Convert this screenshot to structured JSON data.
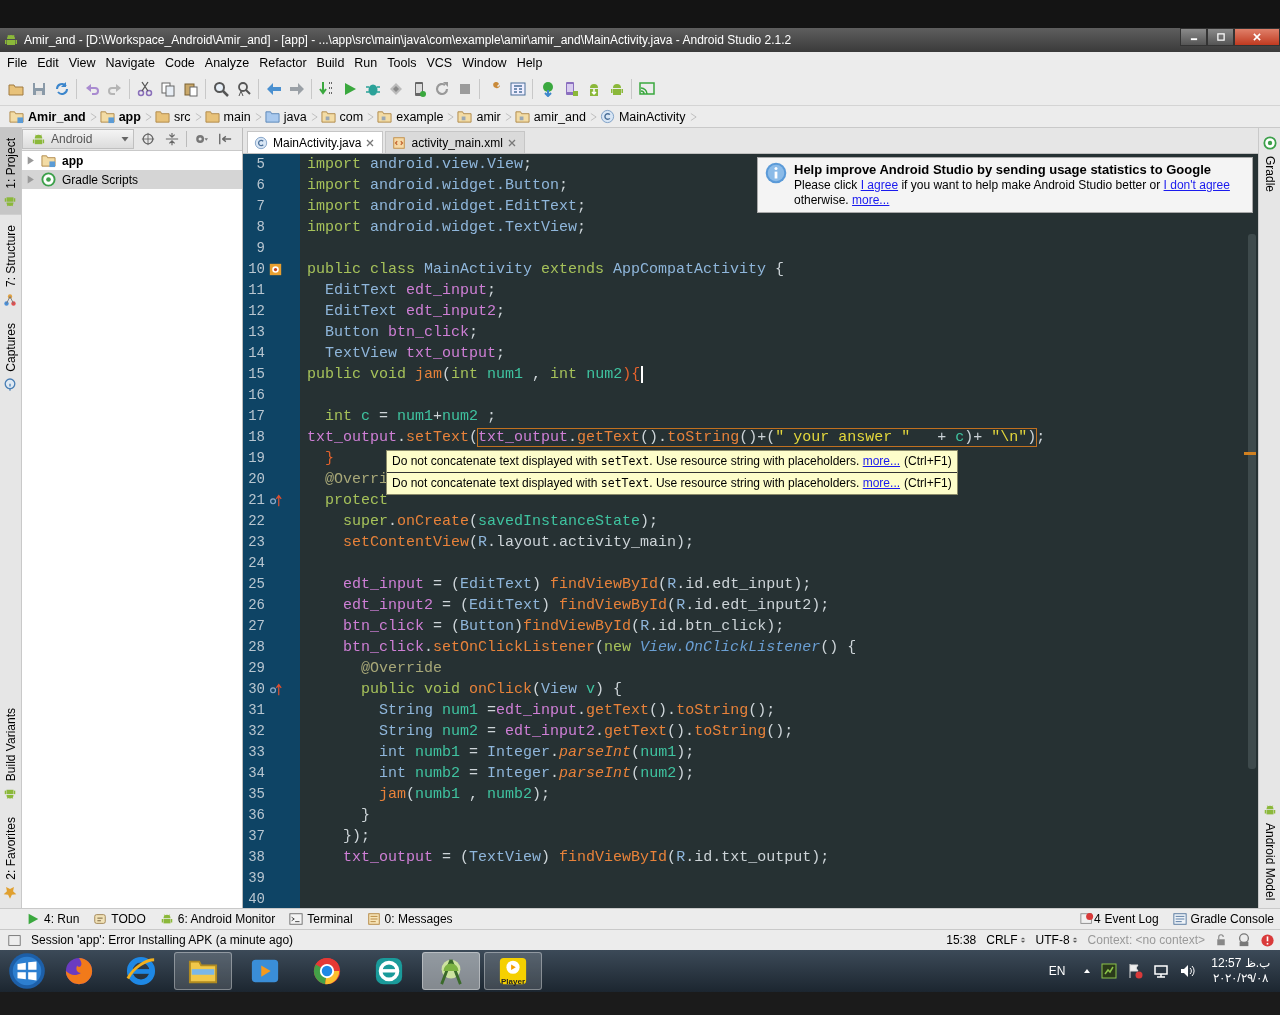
{
  "title_bar": {
    "title": "Amir_and - [D:\\Workspace_Android\\Amir_and] - [app] - ...\\app\\src\\main\\java\\com\\example\\amir\\amir_and\\MainActivity.java - Android Studio 2.1.2"
  },
  "menu": [
    "File",
    "Edit",
    "View",
    "Navigate",
    "Code",
    "Analyze",
    "Refactor",
    "Build",
    "Run",
    "Tools",
    "VCS",
    "Window",
    "Help"
  ],
  "breadcrumb": [
    {
      "label": "Amir_and",
      "kind": "module"
    },
    {
      "label": "app",
      "kind": "module"
    },
    {
      "label": "src",
      "kind": "folder"
    },
    {
      "label": "main",
      "kind": "folder"
    },
    {
      "label": "java",
      "kind": "source"
    },
    {
      "label": "com",
      "kind": "package"
    },
    {
      "label": "example",
      "kind": "package"
    },
    {
      "label": "amir",
      "kind": "package"
    },
    {
      "label": "amir_and",
      "kind": "package"
    },
    {
      "label": "MainActivity",
      "kind": "class"
    }
  ],
  "left_stripe": {
    "top": [
      {
        "label": "1: Project",
        "kind": "robot",
        "selected": true
      },
      {
        "label": "7: Structure",
        "kind": "structure",
        "selected": false
      },
      {
        "label": "Captures",
        "kind": "capture",
        "selected": false
      }
    ],
    "bottom": [
      {
        "label": "Build Variants",
        "kind": "robot",
        "selected": false
      },
      {
        "label": "2: Favorites",
        "kind": "star",
        "selected": false
      }
    ]
  },
  "project_panel": {
    "view": "Android",
    "tree": [
      {
        "label": "app",
        "kind": "module",
        "expanded": false,
        "selected": false
      },
      {
        "label": "Gradle Scripts",
        "kind": "gradle",
        "expanded": false,
        "selected": true
      }
    ]
  },
  "editor_tabs": [
    {
      "label": "MainActivity.java",
      "kind": "class",
      "selected": true
    },
    {
      "label": "activity_main.xml",
      "kind": "xml",
      "selected": false
    }
  ],
  "code_lines": [
    {
      "n": "5",
      "tokens": [
        {
          "text": "import ",
          "kind": "kw"
        },
        {
          "text": "android.view.View",
          "kind": "type"
        },
        {
          "text": ";",
          "kind": "p"
        }
      ]
    },
    {
      "n": "6",
      "tokens": [
        {
          "text": "import ",
          "kind": "kw"
        },
        {
          "text": "android.widget.Button",
          "kind": "type"
        },
        {
          "text": ";",
          "kind": "p"
        }
      ]
    },
    {
      "n": "7",
      "tokens": [
        {
          "text": "import ",
          "kind": "kw"
        },
        {
          "text": "android.widget.EditText",
          "kind": "type"
        },
        {
          "text": ";",
          "kind": "p"
        }
      ]
    },
    {
      "n": "8",
      "tokens": [
        {
          "text": "import ",
          "kind": "kw"
        },
        {
          "text": "android.widget.TextView",
          "kind": "type"
        },
        {
          "text": ";",
          "kind": "p"
        }
      ]
    },
    {
      "n": "9"
    },
    {
      "n": "10",
      "kind": "class",
      "tokens": [
        {
          "text": "public class ",
          "kind": "kw"
        },
        {
          "text": "MainActivity ",
          "kind": "type"
        },
        {
          "text": "extends ",
          "kind": "kw"
        },
        {
          "text": "AppCompatActivity ",
          "kind": "type"
        },
        {
          "text": "{",
          "kind": "p"
        }
      ]
    },
    {
      "n": "11",
      "tokens": [
        {
          "text": "  EditText ",
          "kind": "type"
        },
        {
          "text": "edt_input",
          "kind": "field"
        },
        {
          "text": ";",
          "kind": "p"
        }
      ]
    },
    {
      "n": "12",
      "tokens": [
        {
          "text": "  EditText ",
          "kind": "type"
        },
        {
          "text": "edt_input2",
          "kind": "field"
        },
        {
          "text": ";",
          "kind": "p"
        }
      ]
    },
    {
      "n": "13",
      "tokens": [
        {
          "text": "  Button ",
          "kind": "type"
        },
        {
          "text": "btn_click",
          "kind": "field"
        },
        {
          "text": ";",
          "kind": "p"
        }
      ]
    },
    {
      "n": "14",
      "tokens": [
        {
          "text": "  TextView ",
          "kind": "type"
        },
        {
          "text": "txt_output",
          "kind": "field"
        },
        {
          "text": ";",
          "kind": "p"
        }
      ]
    },
    {
      "n": "15",
      "caret": true,
      "tokens": [
        {
          "text": "public void ",
          "kind": "kw"
        },
        {
          "text": "jam",
          "kind": "method"
        },
        {
          "text": "(",
          "kind": "p"
        },
        {
          "text": "int ",
          "kind": "kw"
        },
        {
          "text": "num1 ",
          "kind": "local"
        },
        {
          "text": ", ",
          "kind": "p"
        },
        {
          "text": "int ",
          "kind": "kw"
        },
        {
          "text": "num2",
          "kind": "local"
        },
        {
          "text": "){",
          "kind": "match"
        }
      ]
    },
    {
      "n": "16"
    },
    {
      "n": "17",
      "tokens": [
        {
          "text": "  int ",
          "kind": "kw"
        },
        {
          "text": "c ",
          "kind": "local"
        },
        {
          "text": "= ",
          "kind": "p"
        },
        {
          "text": "num1",
          "kind": "local"
        },
        {
          "text": "+",
          "kind": "p"
        },
        {
          "text": "num2 ",
          "kind": "local"
        },
        {
          "text": ";",
          "kind": "p"
        }
      ]
    },
    {
      "n": "18",
      "segments": [
        {
          "highlighted": false,
          "tokens": [
            {
              "text": "txt_output",
              "kind": "field"
            },
            {
              "text": ".",
              "kind": "p"
            },
            {
              "text": "setText",
              "kind": "method"
            },
            {
              "text": "(",
              "kind": "p"
            }
          ]
        },
        {
          "highlighted": true,
          "tokens": [
            {
              "text": "txt_output",
              "kind": "field"
            },
            {
              "text": ".",
              "kind": "p"
            },
            {
              "text": "getText",
              "kind": "method"
            },
            {
              "text": "().",
              "kind": "p"
            },
            {
              "text": "toString",
              "kind": "method"
            },
            {
              "text": "()+(",
              "kind": "p"
            },
            {
              "text": "\" your answer \"",
              "kind": "str"
            },
            {
              "text": "   + ",
              "kind": "p"
            },
            {
              "text": "c",
              "kind": "local"
            },
            {
              "text": ")+ ",
              "kind": "p"
            },
            {
              "text": "\"\\n\"",
              "kind": "str"
            },
            {
              "text": ")",
              "kind": "p"
            }
          ]
        },
        {
          "highlighted": false,
          "tokens": [
            {
              "text": ";",
              "kind": "p"
            }
          ]
        }
      ]
    },
    {
      "n": "19",
      "tokens": [
        {
          "text": "  }",
          "kind": "match"
        }
      ]
    },
    {
      "n": "20",
      "tokens": [
        {
          "text": "  @Overri",
          "kind": "anno"
        }
      ]
    },
    {
      "n": "21",
      "kind": "override",
      "tokens": [
        {
          "text": "  protect",
          "kind": "kw"
        }
      ]
    },
    {
      "n": "22",
      "tokens": [
        {
          "text": "    super",
          "kind": "kw"
        },
        {
          "text": ".",
          "kind": "p"
        },
        {
          "text": "onCreate",
          "kind": "method"
        },
        {
          "text": "(",
          "kind": "p"
        },
        {
          "text": "savedInstanceState",
          "kind": "local"
        },
        {
          "text": ");",
          "kind": "p"
        }
      ]
    },
    {
      "n": "23",
      "tokens": [
        {
          "text": "    setContentView",
          "kind": "method"
        },
        {
          "text": "(",
          "kind": "p"
        },
        {
          "text": "R",
          "kind": "type"
        },
        {
          "text": ".layout.activity_main);",
          "kind": "p"
        }
      ]
    },
    {
      "n": "24"
    },
    {
      "n": "25",
      "tokens": [
        {
          "text": "    edt_input",
          "kind": "field"
        },
        {
          "text": " = (",
          "kind": "p"
        },
        {
          "text": "EditText",
          "kind": "type"
        },
        {
          "text": ") ",
          "kind": "p"
        },
        {
          "text": "findViewById",
          "kind": "method"
        },
        {
          "text": "(",
          "kind": "p"
        },
        {
          "text": "R",
          "kind": "type"
        },
        {
          "text": ".id.edt_input);",
          "kind": "p"
        }
      ]
    },
    {
      "n": "26",
      "tokens": [
        {
          "text": "    edt_input2",
          "kind": "field"
        },
        {
          "text": " = (",
          "kind": "p"
        },
        {
          "text": "EditText",
          "kind": "type"
        },
        {
          "text": ") ",
          "kind": "p"
        },
        {
          "text": "findViewById",
          "kind": "method"
        },
        {
          "text": "(",
          "kind": "p"
        },
        {
          "text": "R",
          "kind": "type"
        },
        {
          "text": ".id.edt_input2);",
          "kind": "p"
        }
      ]
    },
    {
      "n": "27",
      "tokens": [
        {
          "text": "    btn_click",
          "kind": "field"
        },
        {
          "text": " = (",
          "kind": "p"
        },
        {
          "text": "Button",
          "kind": "type"
        },
        {
          "text": ")",
          "kind": "p"
        },
        {
          "text": "findViewById",
          "kind": "method"
        },
        {
          "text": "(",
          "kind": "p"
        },
        {
          "text": "R",
          "kind": "type"
        },
        {
          "text": ".id.btn_click);",
          "kind": "p"
        }
      ]
    },
    {
      "n": "28",
      "tokens": [
        {
          "text": "    btn_click",
          "kind": "field"
        },
        {
          "text": ".",
          "kind": "p"
        },
        {
          "text": "setOnClickListener",
          "kind": "method"
        },
        {
          "text": "(",
          "kind": "p"
        },
        {
          "text": "new ",
          "kind": "kw"
        },
        {
          "text": "View.OnClickListener",
          "kind": "italic"
        },
        {
          "text": "() {",
          "kind": "p"
        }
      ]
    },
    {
      "n": "29",
      "tokens": [
        {
          "text": "      @Override",
          "kind": "anno"
        }
      ]
    },
    {
      "n": "30",
      "kind": "override",
      "tokens": [
        {
          "text": "      public void ",
          "kind": "kw"
        },
        {
          "text": "onClick",
          "kind": "method"
        },
        {
          "text": "(",
          "kind": "p"
        },
        {
          "text": "View ",
          "kind": "type"
        },
        {
          "text": "v",
          "kind": "local"
        },
        {
          "text": ") {",
          "kind": "p"
        }
      ]
    },
    {
      "n": "31",
      "tokens": [
        {
          "text": "        String ",
          "kind": "type"
        },
        {
          "text": "num1 ",
          "kind": "local"
        },
        {
          "text": "=",
          "kind": "p"
        },
        {
          "text": "edt_input",
          "kind": "field"
        },
        {
          "text": ".",
          "kind": "p"
        },
        {
          "text": "getText",
          "kind": "method"
        },
        {
          "text": "().",
          "kind": "p"
        },
        {
          "text": "toString",
          "kind": "method"
        },
        {
          "text": "();",
          "kind": "p"
        }
      ]
    },
    {
      "n": "32",
      "tokens": [
        {
          "text": "        String ",
          "kind": "type"
        },
        {
          "text": "num2 ",
          "kind": "local"
        },
        {
          "text": "= ",
          "kind": "p"
        },
        {
          "text": "edt_input2",
          "kind": "field"
        },
        {
          "text": ".",
          "kind": "p"
        },
        {
          "text": "getText",
          "kind": "method"
        },
        {
          "text": "().",
          "kind": "p"
        },
        {
          "text": "toString",
          "kind": "method"
        },
        {
          "text": "();",
          "kind": "p"
        }
      ]
    },
    {
      "n": "33",
      "tokens": [
        {
          "text": "        int ",
          "kind": "type"
        },
        {
          "text": "numb1 ",
          "kind": "local"
        },
        {
          "text": "= ",
          "kind": "p"
        },
        {
          "text": "Integer",
          "kind": "type"
        },
        {
          "text": ".",
          "kind": "p"
        },
        {
          "text": "parseInt",
          "kind": "static"
        },
        {
          "text": "(",
          "kind": "p"
        },
        {
          "text": "num1",
          "kind": "local"
        },
        {
          "text": ");",
          "kind": "p"
        }
      ]
    },
    {
      "n": "34",
      "tokens": [
        {
          "text": "        int ",
          "kind": "type"
        },
        {
          "text": "numb2 ",
          "kind": "local"
        },
        {
          "text": "= ",
          "kind": "p"
        },
        {
          "text": "Integer",
          "kind": "type"
        },
        {
          "text": ".",
          "kind": "p"
        },
        {
          "text": "parseInt",
          "kind": "static"
        },
        {
          "text": "(",
          "kind": "p"
        },
        {
          "text": "num2",
          "kind": "local"
        },
        {
          "text": ");",
          "kind": "p"
        }
      ]
    },
    {
      "n": "35",
      "tokens": [
        {
          "text": "        jam",
          "kind": "method"
        },
        {
          "text": "(",
          "kind": "p"
        },
        {
          "text": "numb1 ",
          "kind": "local"
        },
        {
          "text": ", ",
          "kind": "p"
        },
        {
          "text": "numb2",
          "kind": "local"
        },
        {
          "text": ");",
          "kind": "p"
        }
      ]
    },
    {
      "n": "36",
      "tokens": [
        {
          "text": "      }",
          "kind": "p"
        }
      ]
    },
    {
      "n": "37",
      "tokens": [
        {
          "text": "    });",
          "kind": "p"
        }
      ]
    },
    {
      "n": "38",
      "tokens": [
        {
          "text": "    txt_output",
          "kind": "field"
        },
        {
          "text": " = (",
          "kind": "p"
        },
        {
          "text": "TextView",
          "kind": "type"
        },
        {
          "text": ") ",
          "kind": "p"
        },
        {
          "text": "findViewById",
          "kind": "method"
        },
        {
          "text": "(",
          "kind": "p"
        },
        {
          "text": "R",
          "kind": "type"
        },
        {
          "text": ".id.txt_output);",
          "kind": "p"
        }
      ]
    },
    {
      "n": "39"
    },
    {
      "n": "40"
    }
  ],
  "tooltip": {
    "rows": [
      {
        "before": "Do not concatenate text displayed with ",
        "code": "setText",
        "after": ". Use resource string with placeholders.",
        "link": "more...",
        "shortcut": "(Ctrl+F1)"
      },
      {
        "before": "Do not concatenate text displayed with ",
        "code": "setText",
        "after": ". Use resource string with placeholders.",
        "link": "more...",
        "shortcut": "(Ctrl+F1)"
      }
    ]
  },
  "help_balloon": {
    "title": "Help improve Android Studio by sending usage statistics to Google",
    "segments": [
      {
        "text": "Please click ",
        "link": false
      },
      {
        "text": "I agree",
        "link": true
      },
      {
        "text": " if you want to help make Android Studio better or ",
        "link": false
      },
      {
        "text": "I don't agree",
        "link": true
      },
      {
        "text": " otherwise. ",
        "link": false
      },
      {
        "text": "more...",
        "link": true
      }
    ]
  },
  "right_stripe": {
    "top": [
      {
        "label": "Gradle",
        "kind": "gradle"
      }
    ],
    "bottom": [
      {
        "label": "Android Model",
        "kind": "robot"
      }
    ]
  },
  "bottom_tools": {
    "left": [
      {
        "label": "4: Run",
        "kind": "run"
      },
      {
        "label": "TODO",
        "kind": "todo"
      },
      {
        "label": "6: Android Monitor",
        "kind": "robot"
      },
      {
        "label": "Terminal",
        "kind": "terminal"
      },
      {
        "label": "0: Messages",
        "kind": "messages"
      }
    ],
    "right": [
      {
        "label": "Event Log",
        "kind": "event",
        "badge": "4"
      },
      {
        "label": "Gradle Console",
        "kind": "console"
      }
    ]
  },
  "status_bar": {
    "message": "Session 'app': Error Installing APK (a minute ago)",
    "position": "15:38",
    "line_separator": "CRLF",
    "encoding": "UTF-8",
    "context": "Context: <no context>"
  },
  "taskbar": {
    "apps": [
      {
        "kind": "fox",
        "open": false,
        "selected": false
      },
      {
        "kind": "ebrowser",
        "open": false,
        "selected": false
      },
      {
        "kind": "folder",
        "open": true,
        "selected": false
      },
      {
        "kind": "media",
        "open": false,
        "selected": false
      },
      {
        "kind": "round",
        "open": false,
        "selected": false
      },
      {
        "kind": "shield",
        "open": false,
        "selected": false
      },
      {
        "kind": "robot",
        "open": true,
        "selected": true
      },
      {
        "kind": "player",
        "open": true,
        "selected": false,
        "label": "Player"
      }
    ],
    "language": "EN",
    "time": "ب.ظ 12:57",
    "date": "۲۰۲۰/۲۹/۰۸"
  }
}
